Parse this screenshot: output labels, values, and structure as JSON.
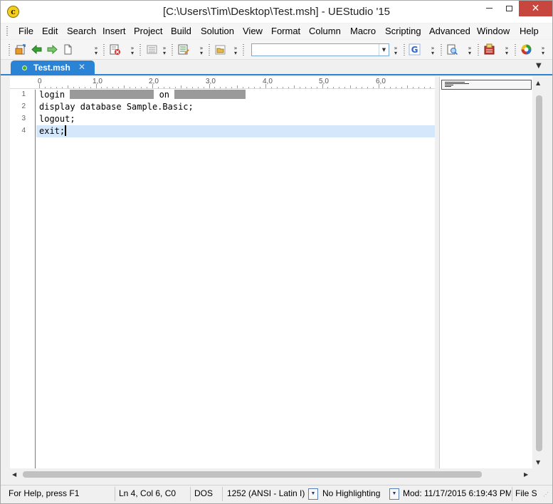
{
  "window": {
    "title": "[C:\\Users\\Tim\\Desktop\\Test.msh] - UEStudio '15",
    "app_icon_glyph": "c",
    "minimize_glyph": "",
    "close_glyph": "✕"
  },
  "menu": {
    "items": [
      {
        "label": "File",
        "mnemonic": "F"
      },
      {
        "label": "Edit",
        "mnemonic": "E"
      },
      {
        "label": "Search",
        "mnemonic": "S"
      },
      {
        "label": "Insert",
        "mnemonic": "I"
      },
      {
        "label": "Project",
        "mnemonic": "P"
      },
      {
        "label": "Build",
        "mnemonic": "B"
      },
      {
        "label": "Solution",
        "mnemonic": "S"
      },
      {
        "label": "View",
        "mnemonic": "V"
      },
      {
        "label": "Format",
        "mnemonic": "m"
      },
      {
        "label": "Column",
        "mnemonic": "C"
      },
      {
        "label": "Macro",
        "mnemonic": "M"
      },
      {
        "label": "Scripting",
        "mnemonic": "S"
      },
      {
        "label": "Advanced",
        "mnemonic": "A"
      },
      {
        "label": "Window",
        "mnemonic": "W"
      },
      {
        "label": "Help",
        "mnemonic": "H"
      }
    ]
  },
  "toolbar": {
    "search_value": "",
    "icons": [
      "open-file-icon",
      "back-arrow-icon",
      "forward-arrow-icon",
      "new-file-icon",
      "close-file-icon",
      "list-icon",
      "edit-list-icon",
      "folder-icon",
      "google-icon",
      "document-search-icon",
      "settings-box-icon",
      "color-wheel-icon"
    ],
    "colors": {
      "back": "#3aa035",
      "forward": "#3aa035",
      "google": "#2f64c8"
    }
  },
  "tabs": {
    "active": "Test.msh",
    "close_glyph": "✕",
    "dropdown_glyph": "▼"
  },
  "ruler": {
    "labels": [
      "0",
      "1,0",
      "2,0",
      "3,0",
      "4,0",
      "5,0",
      "6,0"
    ]
  },
  "editor": {
    "line_numbers": [
      "1",
      "2",
      "3",
      "4"
    ],
    "lines": [
      {
        "before": "login ",
        "redacted_1": true,
        "middle": " on ",
        "redacted_2": true
      },
      {
        "text": "display database Sample.Basic;"
      },
      {
        "text": "logout;"
      },
      {
        "text": "exit;"
      }
    ],
    "line1_before": "login ",
    "line1_middle": " on ",
    "current_line": 4
  },
  "statusbar": {
    "help": "For Help, press F1",
    "position": "Ln 4, Col 6, C0",
    "line_ending": "DOS",
    "encoding": "1252  (ANSI - Latin I)",
    "highlighting": "No Highlighting",
    "modified": "Mod: 11/17/2015 6:19:43 PM",
    "file_size": "File S"
  },
  "colors": {
    "tab_accent": "#2a83d4",
    "current_line": "#d5e8fb",
    "close_button": "#c7463d"
  }
}
